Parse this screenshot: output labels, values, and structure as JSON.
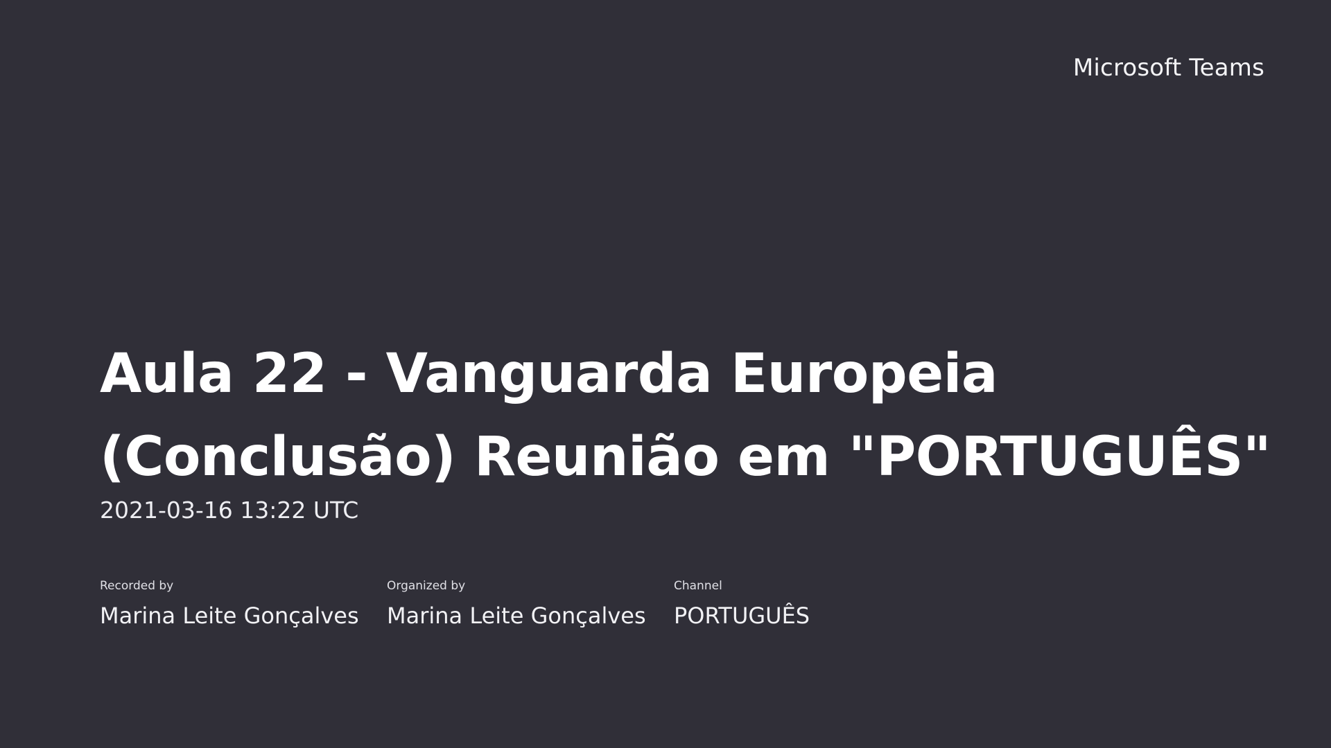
{
  "app": {
    "brand": "Microsoft Teams"
  },
  "meeting": {
    "title_line1": "Aula 22 - Vanguarda Europeia",
    "title_line2": "(Conclusão) Reunião em \"PORTUGUÊS\"",
    "timestamp": "2021-03-16 13:22 UTC"
  },
  "details": [
    {
      "label": "Recorded by",
      "value": "Marina Leite Gonçalves"
    },
    {
      "label": "Organized by",
      "value": "Marina Leite Gonçalves"
    },
    {
      "label": "Channel",
      "value": "PORTUGUÊS"
    }
  ],
  "colors": {
    "background": "#302f38",
    "text": "#ffffff"
  }
}
